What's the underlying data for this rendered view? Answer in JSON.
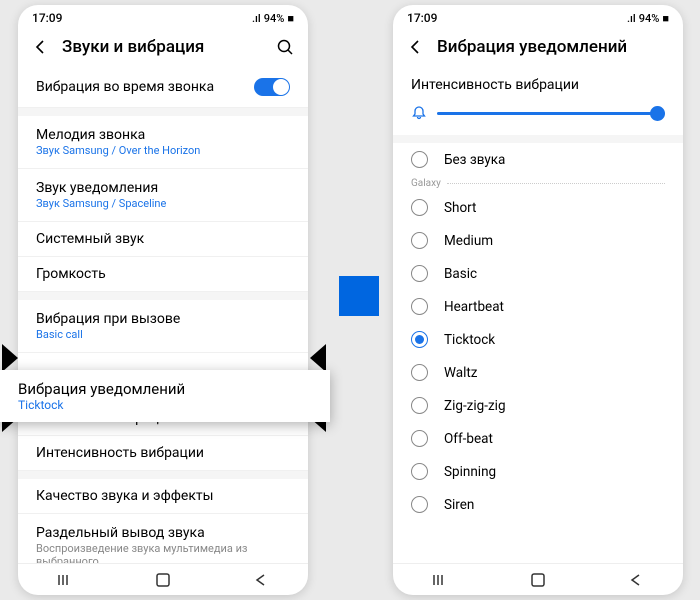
{
  "status": {
    "time": "17:09",
    "battery": "94%"
  },
  "left": {
    "title": "Звуки и вибрация",
    "toggle_row": "Вибрация во время звонка",
    "ringtone": {
      "label": "Мелодия звонка",
      "sub": "Звук Samsung / Over the Horizon"
    },
    "notif_sound": {
      "label": "Звук уведомления",
      "sub": "Звук Samsung / Spaceline"
    },
    "system_sound": "Системный звук",
    "volume": "Громкость",
    "call_vib": {
      "label": "Вибрация при вызове",
      "sub": "Basic call"
    },
    "notif_vib": {
      "label": "Вибрация уведомлений",
      "sub": "Ticktock"
    },
    "system_vib": "Системная вибрация",
    "intensity": "Интенсивность вибрации",
    "quality": "Качество звука и эффекты",
    "separate": {
      "label": "Раздельный вывод звука",
      "sub": "Воспроизведение звука мультимедиа из выбранного"
    }
  },
  "right": {
    "title": "Вибрация уведомлений",
    "intensity_label": "Интенсивность вибрации",
    "silent": "Без звука",
    "group": "Galaxy",
    "options": [
      "Short",
      "Medium",
      "Basic",
      "Heartbeat",
      "Ticktock",
      "Waltz",
      "Zig-zig-zig",
      "Off-beat",
      "Spinning",
      "Siren"
    ],
    "selected": "Ticktock"
  }
}
